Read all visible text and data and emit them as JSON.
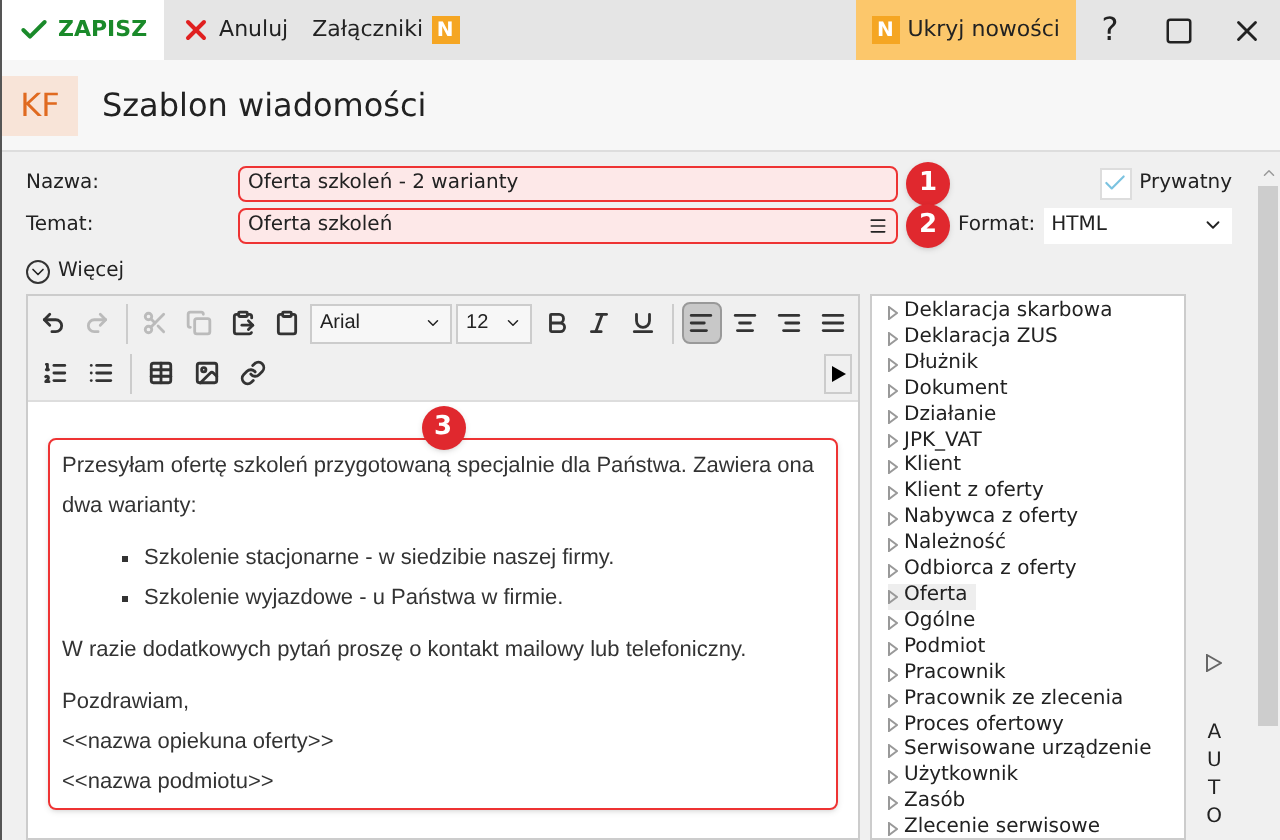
{
  "toolbar": {
    "save": "ZAPISZ",
    "cancel": "Anuluj",
    "attachments": "Załączniki",
    "attachments_badge": "N",
    "news_badge": "N",
    "hide_news": "Ukryj nowości",
    "help": "?"
  },
  "header": {
    "logo": "KF",
    "title": "Szablon wiadomości"
  },
  "form": {
    "name_label": "Nazwa:",
    "name_value": "Oferta szkoleń - 2 warianty",
    "subject_label": "Temat:",
    "subject_value": "Oferta szkoleń",
    "private_label": "Prywatny",
    "private_checked": true,
    "format_label": "Format:",
    "format_value": "HTML",
    "more": "Więcej"
  },
  "callouts": [
    "1",
    "2",
    "3"
  ],
  "editor": {
    "font": "Arial",
    "size": "12",
    "tools": [
      {
        "kind": "undo",
        "disabled": false
      },
      {
        "kind": "redo",
        "disabled": true
      },
      {
        "kind": "sep"
      },
      {
        "kind": "cut",
        "disabled": true
      },
      {
        "kind": "copy",
        "disabled": true
      },
      {
        "kind": "paste",
        "disabled": false
      },
      {
        "kind": "paste-text",
        "disabled": false
      }
    ],
    "format_tools": [
      {
        "kind": "bold",
        "selected": false
      },
      {
        "kind": "italic",
        "selected": false
      },
      {
        "kind": "underline",
        "selected": false
      },
      {
        "kind": "sep"
      },
      {
        "kind": "align-left",
        "selected": true
      },
      {
        "kind": "align-center",
        "selected": false
      },
      {
        "kind": "align-right",
        "selected": false
      },
      {
        "kind": "align-justify",
        "selected": false
      }
    ],
    "row2_tools": [
      {
        "kind": "ordered-list"
      },
      {
        "kind": "bullet-list"
      },
      {
        "kind": "sep"
      },
      {
        "kind": "table"
      },
      {
        "kind": "image"
      },
      {
        "kind": "link"
      }
    ],
    "content": [
      {
        "kind": "paragraph",
        "text": "Przesyłam ofertę szkoleń przygotowaną specjalnie dla Państwa. Zawiera ona dwa warianty:"
      },
      {
        "kind": "list",
        "items": [
          "Szkolenie stacjonarne - w siedzibie naszej firmy.",
          "Szkolenie wyjazdowe - u Państwa w firmie."
        ]
      },
      {
        "kind": "paragraph",
        "text": "W razie dodatkowych pytań proszę o kontakt mailowy lub telefoniczny."
      },
      {
        "kind": "lines",
        "items": [
          "Pozdrawiam,",
          "<<nazwa opiekuna oferty>>",
          "<<nazwa podmiotu>>"
        ]
      }
    ]
  },
  "tree": [
    {
      "label": "Deklaracja skarbowa",
      "selected": false
    },
    {
      "label": "Deklaracja ZUS",
      "selected": false
    },
    {
      "label": "Dłużnik",
      "selected": false
    },
    {
      "label": "Dokument",
      "selected": false
    },
    {
      "label": "Działanie",
      "selected": false
    },
    {
      "label": "JPK_VAT",
      "selected": false
    },
    {
      "label": "Klient",
      "selected": false
    },
    {
      "label": "Klient z oferty",
      "selected": false
    },
    {
      "label": "Nabywca z oferty",
      "selected": false
    },
    {
      "label": "Należność",
      "selected": false
    },
    {
      "label": "Odbiorca z oferty",
      "selected": false
    },
    {
      "label": "Oferta",
      "selected": true
    },
    {
      "label": "Ogólne",
      "selected": false
    },
    {
      "label": "Podmiot",
      "selected": false
    },
    {
      "label": "Pracownik",
      "selected": false
    },
    {
      "label": "Pracownik ze zlecenia",
      "selected": false
    },
    {
      "label": "Proces ofertowy",
      "selected": false
    },
    {
      "label": "Serwisowane urządzenie",
      "selected": false
    },
    {
      "label": "Użytkownik",
      "selected": false
    },
    {
      "label": "Zasób",
      "selected": false
    },
    {
      "label": "Zlecenie serwisowe",
      "selected": false
    }
  ],
  "side_panel": {
    "label": "AUTO"
  }
}
